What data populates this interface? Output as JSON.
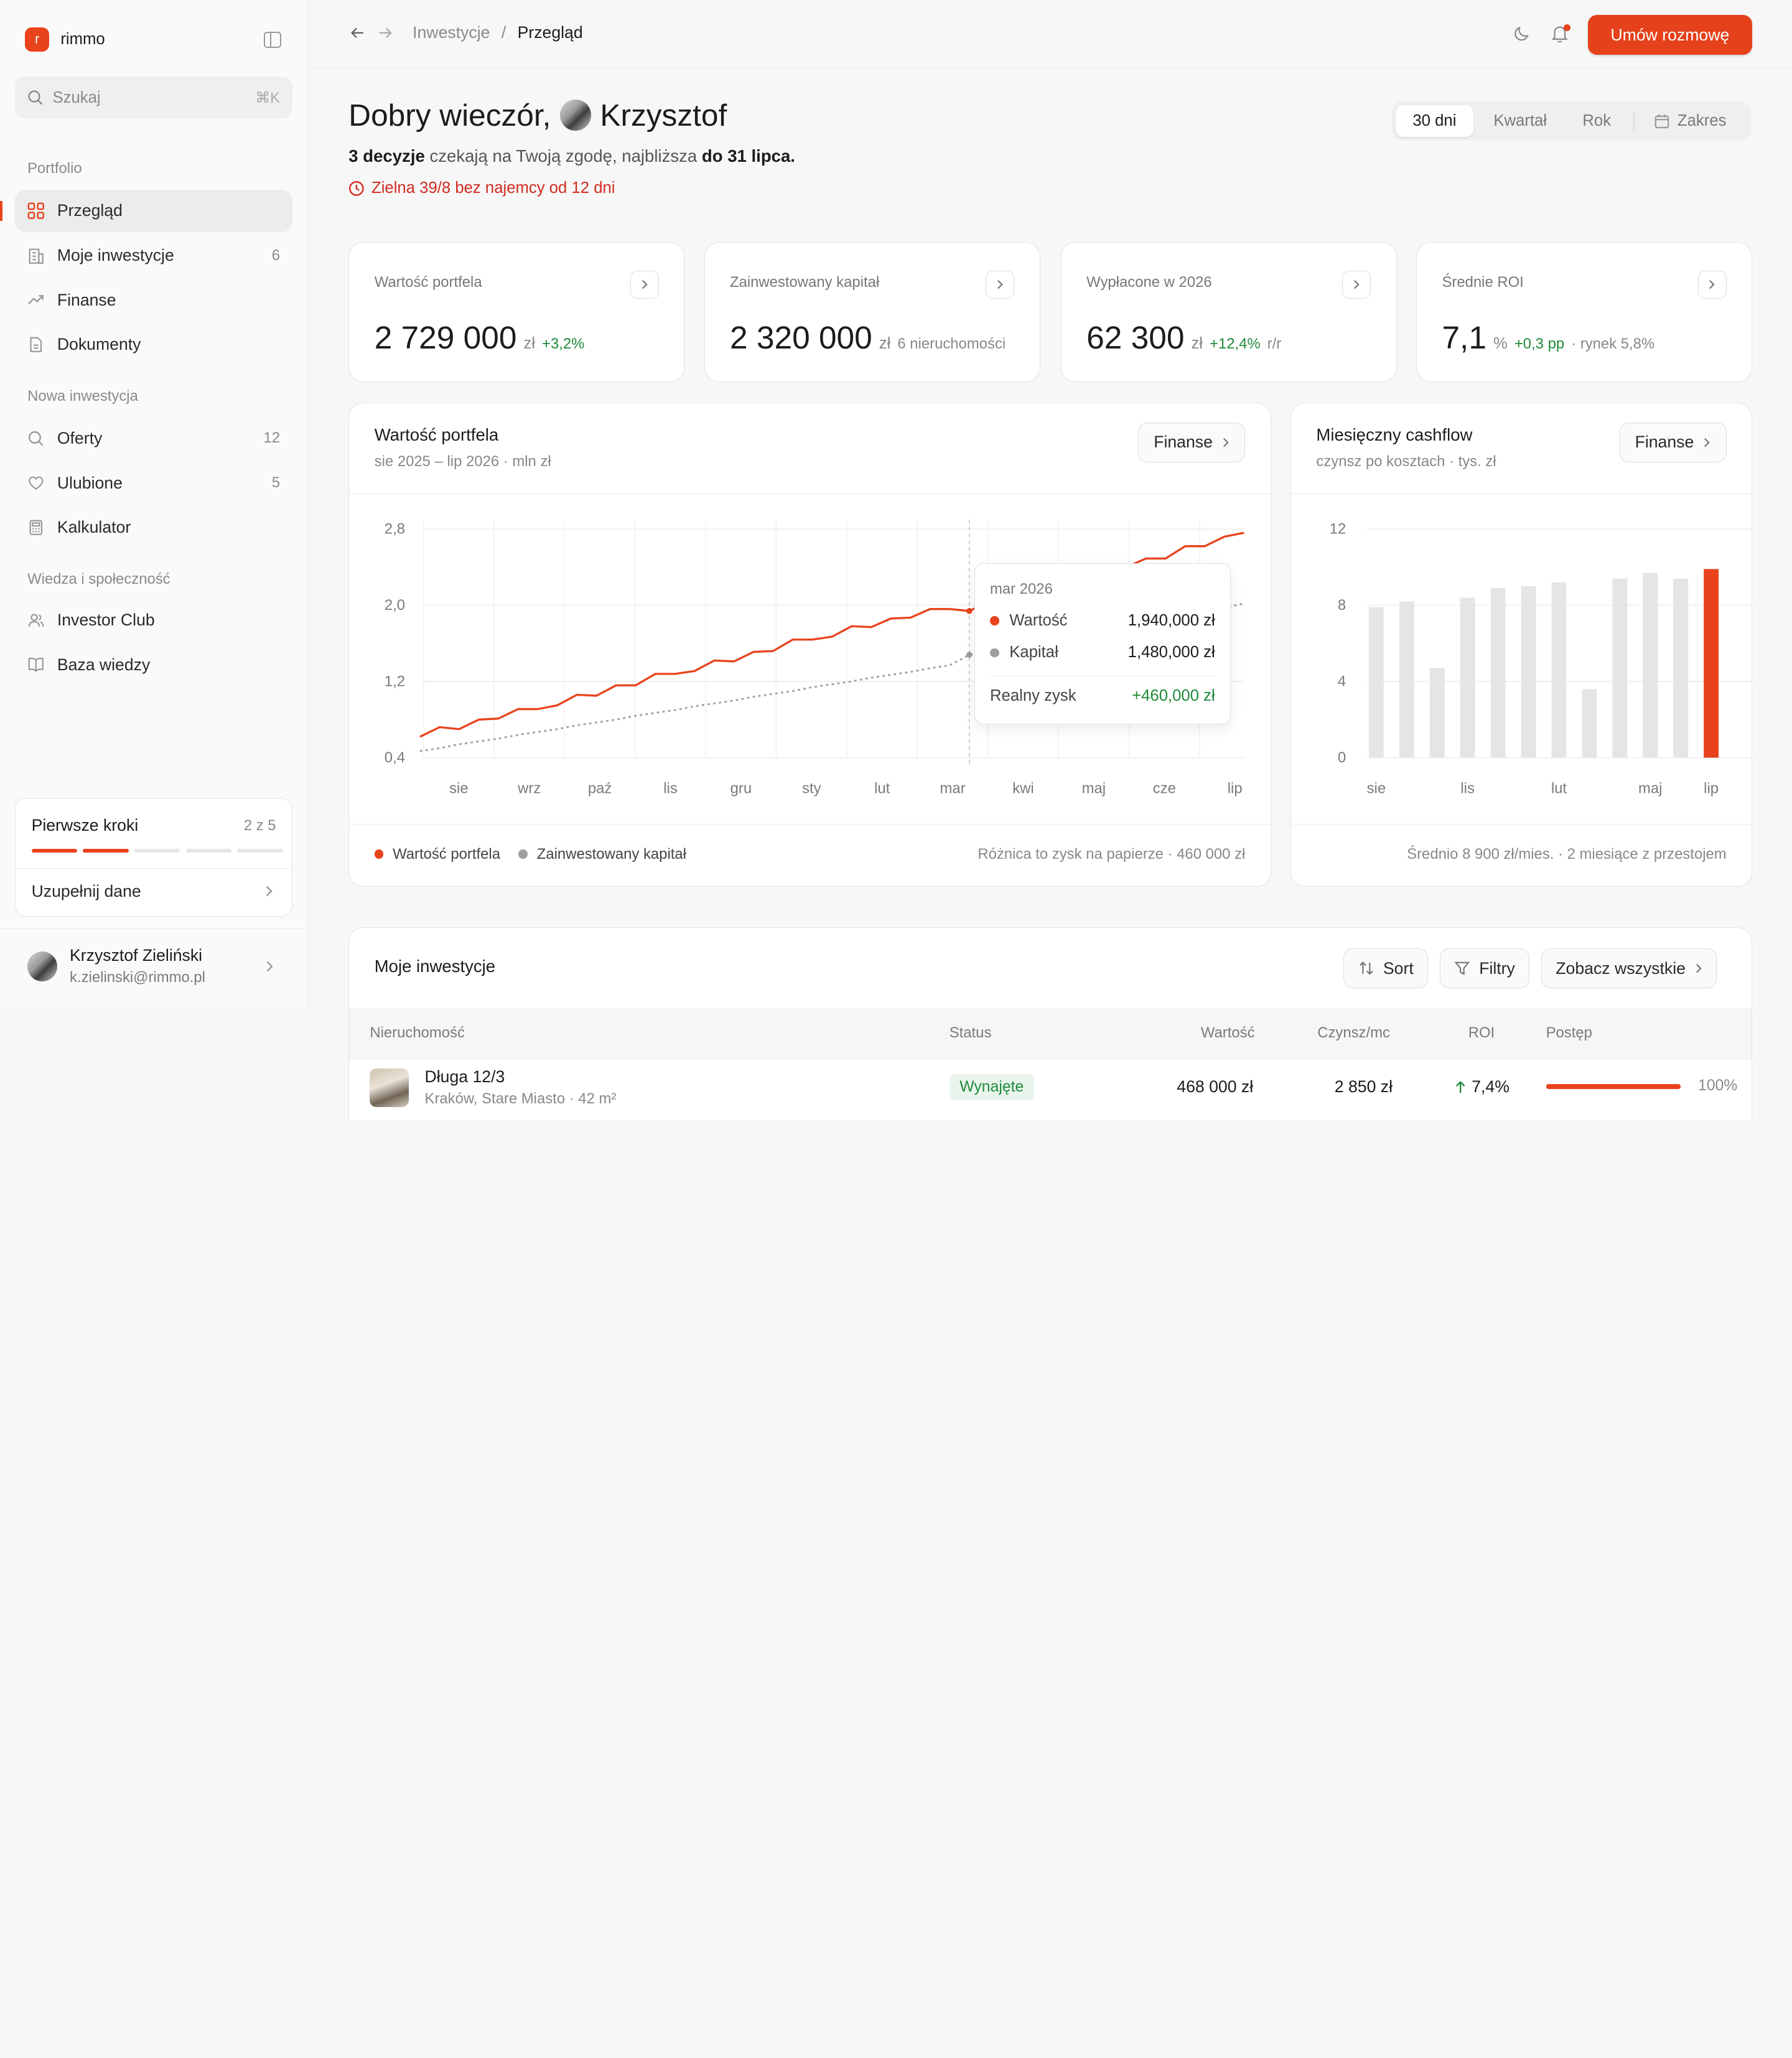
{
  "sidebar": {
    "brand_letter": "r",
    "brand_name": "rimmo",
    "search_placeholder": "Szukaj",
    "search_shortcut": "⌘K",
    "section_portfolio": "Portfolio",
    "section_new": "Nowa inwestycja",
    "section_knowledge": "Wiedza i społeczność",
    "items": [
      {
        "label": "Przegląd",
        "icon": "grid-icon",
        "count": ""
      },
      {
        "label": "Moje inwestycje",
        "icon": "building-icon",
        "count": "6"
      },
      {
        "label": "Finanse",
        "icon": "trend-up-icon",
        "count": ""
      },
      {
        "label": "Dokumenty",
        "icon": "document-icon",
        "count": ""
      },
      {
        "label": "Oferty",
        "icon": "search-icon",
        "count": "12"
      },
      {
        "label": "Ulubione",
        "icon": "heart-icon",
        "count": "5"
      },
      {
        "label": "Kalkulator",
        "icon": "calculator-icon",
        "count": ""
      },
      {
        "label": "Investor Club",
        "icon": "users-icon",
        "count": ""
      },
      {
        "label": "Baza wiedzy",
        "icon": "book-icon",
        "count": ""
      }
    ],
    "first_steps": {
      "title": "Pierwsze kroki",
      "count": "2 z 5",
      "done": 2,
      "total": 5,
      "link": "Uzupełnij dane"
    },
    "user": {
      "name": "Krzysztof Zieliński",
      "email": "k.zielinski@rimmo.pl"
    }
  },
  "topbar": {
    "breadcrumb": [
      "Inwestycje",
      "Przegląd"
    ],
    "separator": "/",
    "cta": "Umów rozmowę"
  },
  "header": {
    "greeting": "Dobry wieczór,",
    "name": "Krzysztof",
    "sub_bold1": "3 decyzje",
    "sub_text": " czekają na Twoją zgodę, najbliższa ",
    "sub_bold2": "do 31 lipca.",
    "alert": "Zielna 39/8 bez najemcy od 12 dni",
    "ranges": [
      "30 dni",
      "Kwartał",
      "Rok",
      "Zakres"
    ],
    "range_active": "30 dni"
  },
  "kpis": [
    {
      "label": "Wartość portfela",
      "value": "2 729 000",
      "unit": "zł",
      "delta": "+3,2%",
      "note": ""
    },
    {
      "label": "Zainwestowany kapitał",
      "value": "2 320 000",
      "unit": "zł",
      "delta": "",
      "note": "6 nieruchomości"
    },
    {
      "label": "Wypłacone w 2026",
      "value": "62 300",
      "unit": "zł",
      "delta": "+12,4%",
      "note": "r/r"
    },
    {
      "label": "Średnie ROI",
      "value": "7,1",
      "unit": "%",
      "delta": "+0,3 pp",
      "note": "· rynek 5,8%"
    }
  ],
  "portfolio_card": {
    "title": "Wartość portfela",
    "subtitle": "sie 2025 – lip 2026 · mln zł",
    "button": "Finanse",
    "legend": [
      "Wartość portfela",
      "Zainwestowany kapitał"
    ],
    "note": "Różnica to zysk na papierze · 460 000 zł",
    "tooltip": {
      "month": "mar 2026",
      "rows": [
        {
          "label": "Wartość",
          "value": "1,940,000 zł"
        },
        {
          "label": "Kapitał",
          "value": "1,480,000 zł"
        }
      ],
      "total_label": "Realny zysk",
      "total_value": "+460,000 zł"
    }
  },
  "cashflow_card": {
    "title": "Miesięczny cashflow",
    "subtitle": "czynsz po kosztach · tys. zł",
    "button": "Finanse",
    "note": "Średnio 8 900 zł/mies. · 2 miesiące z przestojem"
  },
  "investments": {
    "title": "Moje inwestycje",
    "buttons": [
      "Sort",
      "Filtry",
      "Zobacz wszystkie"
    ],
    "columns": [
      "Nieruchomość",
      "Status",
      "Wartość",
      "Czynsz/mc",
      "ROI",
      "Postęp"
    ],
    "rows": [
      {
        "name": "Długa 12/3",
        "location": "Kraków, Stare Miasto · 42 m²",
        "status": "Wynajęte",
        "value": "468 000 zł",
        "rent": "2 850 zł",
        "roi": "7,4%",
        "progress": 100,
        "progress_label": "100%"
      }
    ]
  },
  "chart_data": [
    {
      "type": "line",
      "title": "Wartość portfela",
      "subtitle": "sie 2025 – lip 2026 · mln zł",
      "x_ticks": [
        "sie",
        "wrz",
        "paź",
        "lis",
        "gru",
        "sty",
        "lut",
        "mar",
        "kwi",
        "maj",
        "cze",
        "lip"
      ],
      "y_ticks": [
        "0,4",
        "1,2",
        "2,0",
        "2,8"
      ],
      "ylim": [
        0.4,
        2.8
      ],
      "grid": true,
      "series": [
        {
          "name": "Wartość portfela",
          "color": "#e8431c",
          "style": "solid",
          "values": [
            0.62,
            0.72,
            0.7,
            0.8,
            0.81,
            0.91,
            0.91,
            0.95,
            1.06,
            1.05,
            1.16,
            1.16,
            1.28,
            1.28,
            1.31,
            1.42,
            1.41,
            1.51,
            1.52,
            1.64,
            1.64,
            1.67,
            1.78,
            1.77,
            1.86,
            1.87,
            1.96,
            1.96,
            1.94,
            2.04,
            2.03,
            2.14,
            2.13,
            2.2,
            2.28,
            2.36,
            2.4,
            2.49,
            2.49,
            2.62,
            2.62,
            2.72,
            2.76
          ]
        },
        {
          "name": "Zainwestowany kapitał",
          "color": "#9e9e9e",
          "style": "dashed",
          "values": [
            0.47,
            0.5,
            0.54,
            0.57,
            0.6,
            0.64,
            0.67,
            0.7,
            0.74,
            0.77,
            0.8,
            0.84,
            0.87,
            0.9,
            0.94,
            0.97,
            1.0,
            1.04,
            1.07,
            1.1,
            1.14,
            1.17,
            1.2,
            1.24,
            1.27,
            1.3,
            1.34,
            1.37,
            1.48,
            1.5,
            1.53,
            1.57,
            1.61,
            1.65,
            1.69,
            1.73,
            1.77,
            1.81,
            1.85,
            1.89,
            1.93,
            1.97,
            2.02
          ]
        }
      ],
      "highlight": {
        "x": "mar",
        "index": 28
      }
    },
    {
      "type": "bar",
      "title": "Miesięczny cashflow",
      "subtitle": "czynsz po kosztach · tys. zł",
      "x_ticks": [
        "sie",
        "lis",
        "lut",
        "maj",
        "lip"
      ],
      "y_ticks": [
        "0",
        "4",
        "8",
        "12"
      ],
      "ylim": [
        0,
        12
      ],
      "grid": true,
      "categories": [
        "sie",
        "wrz",
        "paź",
        "lis",
        "gru",
        "sty",
        "lut",
        "mar",
        "kwi",
        "maj",
        "cze",
        "lip"
      ],
      "values": [
        7.9,
        8.2,
        4.7,
        8.4,
        8.9,
        9.0,
        9.2,
        3.6,
        9.4,
        9.7,
        9.4,
        9.9
      ],
      "colors": {
        "default": "#e5e5e5",
        "highlight": "#e8431c"
      },
      "highlight_index": 11
    }
  ]
}
